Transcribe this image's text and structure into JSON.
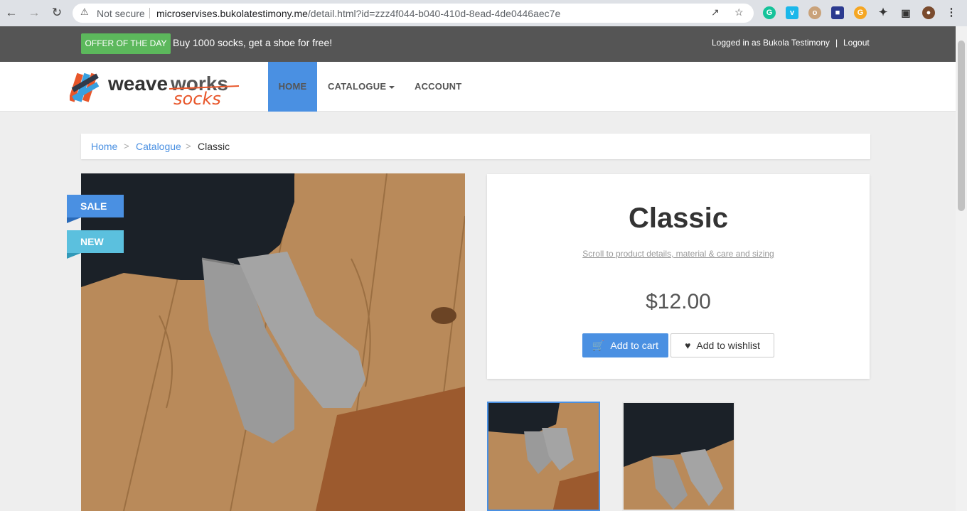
{
  "browser": {
    "not_secure": "Not secure",
    "url_host": "microservises.bukolatestimony.me",
    "url_path": "/detail.html?id=zzz4f044-b040-410d-8ead-4de0446aec7e"
  },
  "topbar": {
    "offer_badge": "OFFER OF THE DAY",
    "offer_text": "Buy 1000 socks, get a shoe for free!",
    "login_status": "Logged in as Bukola Testimony",
    "separator": "|",
    "logout": "Logout"
  },
  "logo": {
    "word1": "weave",
    "word2": "works",
    "word3": "socks"
  },
  "nav": {
    "home": "HOME",
    "catalogue": "CATALOGUE",
    "account": "ACCOUNT"
  },
  "breadcrumb": {
    "home": "Home",
    "catalogue": "Catalogue",
    "current": "Classic",
    "separator": ">"
  },
  "product": {
    "ribbon_sale": "SALE",
    "ribbon_new": "NEW",
    "title": "Classic",
    "scroll_link": "Scroll to product details, material & care and sizing",
    "price": "$12.00",
    "add_to_cart": "Add to cart",
    "add_to_wishlist": "Add to wishlist"
  },
  "colors": {
    "accent": "#4a90e2",
    "offer_green": "#5cb85c",
    "topbar": "#555555",
    "ribbon_new": "#5bc0de"
  }
}
